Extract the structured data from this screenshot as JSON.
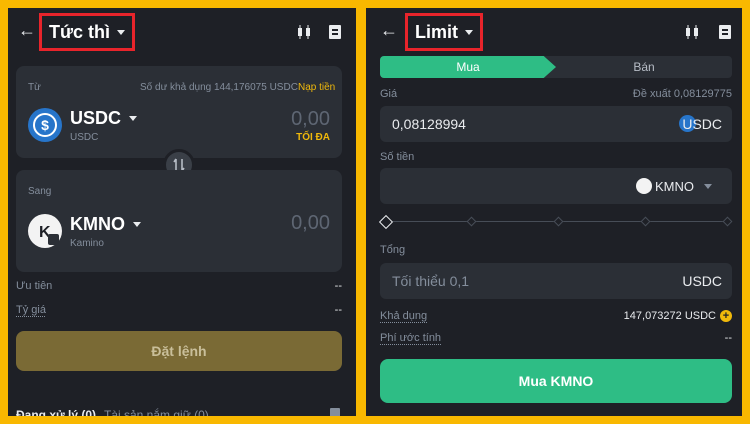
{
  "left": {
    "title": "Tức thì",
    "from_label": "Từ",
    "available_label": "Số dư khả dụng 144,176075 USDC",
    "deposit_link": "Nạp tiền",
    "from_coin": {
      "symbol": "USDC",
      "name": "USDC",
      "amount": "0,00",
      "max_label": "TỐI ĐA"
    },
    "to_label": "Sang",
    "to_coin": {
      "symbol": "KMNO",
      "name": "Kamino",
      "amount": "0,00"
    },
    "priority_label": "Ưu tiên",
    "priority_value": "--",
    "rate_label": "Tỷ giá",
    "rate_value": "--",
    "place_order_button": "Đặt lệnh",
    "bottom_tabs": [
      "Đang xử lý (0)",
      "Tài sản nắm giữ (0)"
    ]
  },
  "right": {
    "title": "Limit",
    "tab_buy": "Mua",
    "tab_sell": "Bán",
    "price_label": "Giá",
    "suggest_label": "Đề xuất 0,08129775",
    "price_value": "0,08128994",
    "price_currency": "USDC",
    "amount_label": "Số tiền",
    "amount_currency": "KMNO",
    "total_label": "Tổng",
    "total_placeholder": "Tối thiểu 0,1",
    "total_currency": "USDC",
    "available_label": "Khả dụng",
    "available_value": "147,073272 USDC",
    "fee_label": "Phí ước tính",
    "fee_value": "--",
    "buy_button": "Mua KMNO"
  },
  "colors": {
    "buy_green": "#2ebd85",
    "accent_yellow": "#f0b90b",
    "usdc_blue": "#2775ca",
    "highlight_red": "#e8242b",
    "frame_yellow": "#f9b800"
  }
}
